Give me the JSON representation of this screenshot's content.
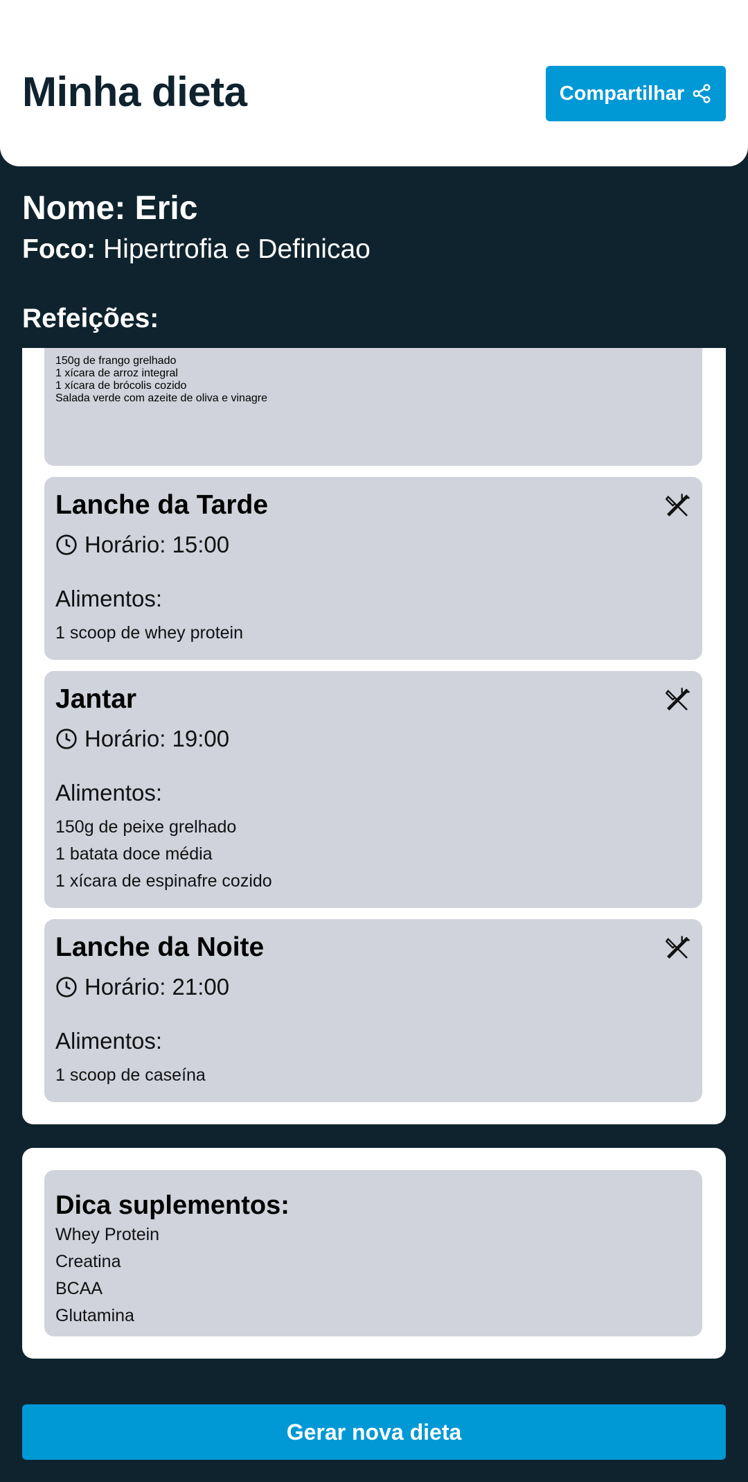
{
  "header": {
    "title": "Minha dieta",
    "share_label": "Compartilhar"
  },
  "profile": {
    "name_text": "Nome: Eric",
    "focus_label": "Foco:",
    "focus_value": "Hipertrofia e Definicao"
  },
  "meals_heading": "Refeições:",
  "meals": [
    {
      "foods": [
        "150g de frango grelhado",
        "1 xícara de arroz integral",
        "1 xícara de brócolis cozido",
        "Salada verde com azeite de oliva e vinagre"
      ]
    },
    {
      "name": "Lanche da Tarde",
      "time_text": "Horário: 15:00",
      "foods_label": "Alimentos:",
      "foods": [
        "1 scoop de whey protein"
      ]
    },
    {
      "name": "Jantar",
      "time_text": "Horário: 19:00",
      "foods_label": "Alimentos:",
      "foods": [
        "150g de peixe grelhado",
        "1 batata doce média",
        "1 xícara de espinafre cozido"
      ]
    },
    {
      "name": "Lanche da Noite",
      "time_text": "Horário: 21:00",
      "foods_label": "Alimentos:",
      "foods": [
        "1 scoop de caseína"
      ]
    }
  ],
  "supplements": {
    "title": "Dica suplementos:",
    "items": [
      "Whey Protein",
      "Creatina",
      "BCAA",
      "Glutamina"
    ]
  },
  "generate_label": "Gerar nova dieta",
  "icons": {
    "share": "share-icon",
    "clock": "clock-icon",
    "meal": "utensils-icon"
  },
  "colors": {
    "accent": "#0098d5",
    "background": "#0f232e",
    "card": "#d0d3db"
  }
}
